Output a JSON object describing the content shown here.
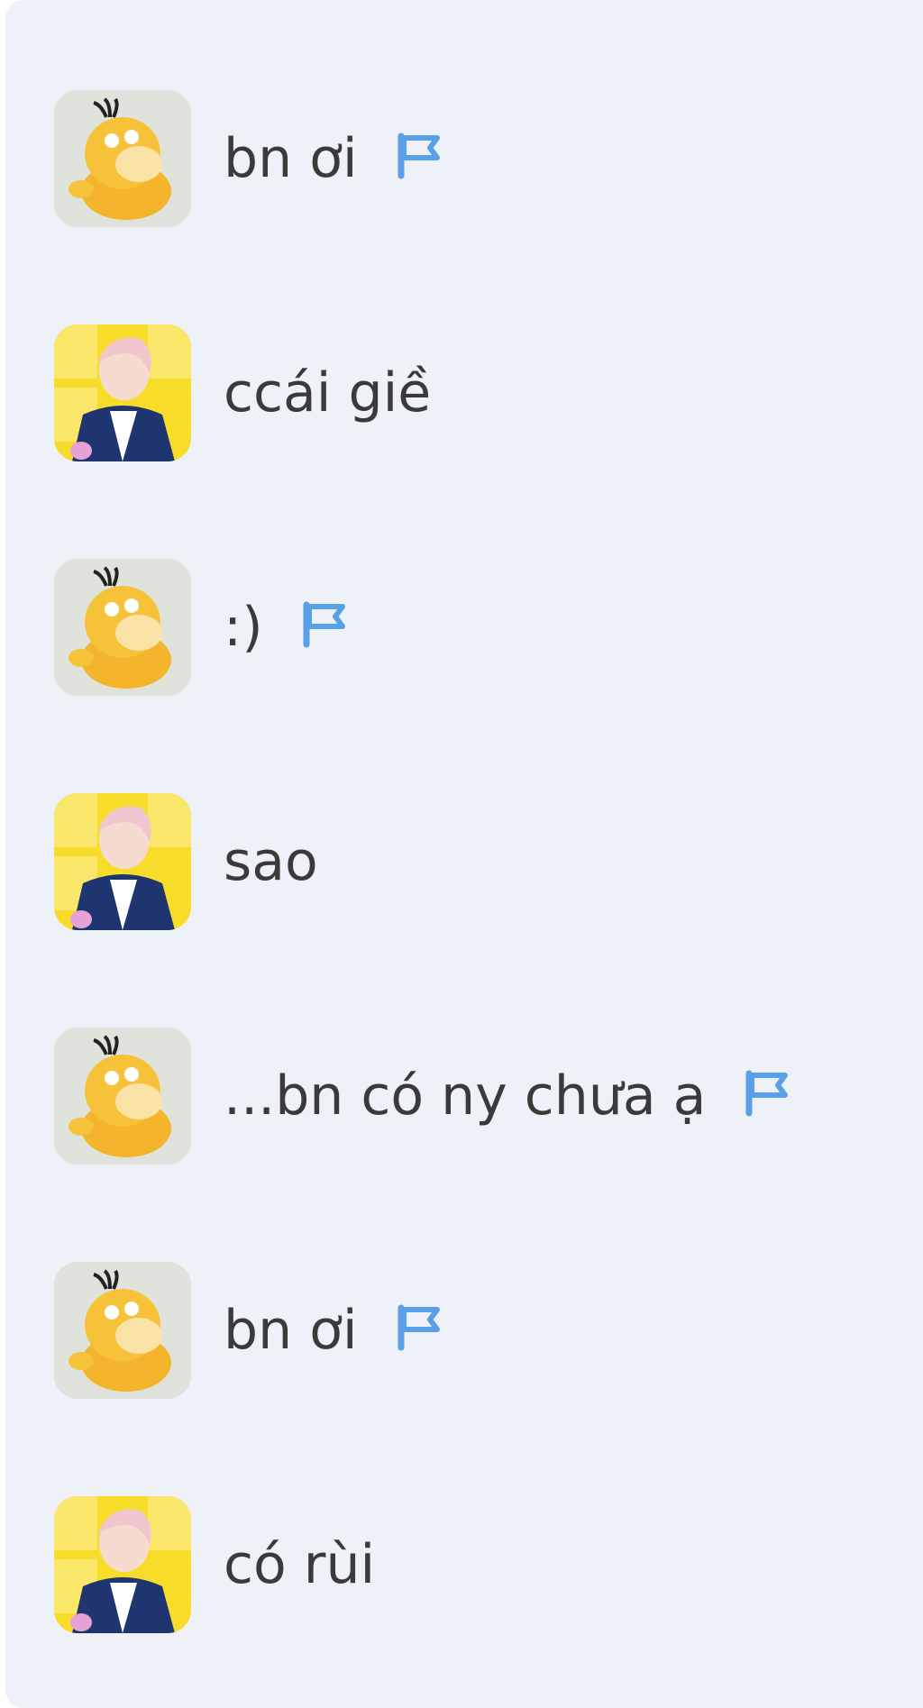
{
  "messages": [
    {
      "sender": "psyduck",
      "text": "bn ơi",
      "flagged": true
    },
    {
      "sender": "anime-boy",
      "text": "ccái giề",
      "flagged": false
    },
    {
      "sender": "psyduck",
      "text": ":)",
      "flagged": true
    },
    {
      "sender": "anime-boy",
      "text": "sao",
      "flagged": false
    },
    {
      "sender": "psyduck",
      "text": "...bn có ny chưa ạ",
      "flagged": true
    },
    {
      "sender": "psyduck",
      "text": "bn ơi",
      "flagged": true
    },
    {
      "sender": "anime-boy",
      "text": "có rùi",
      "flagged": false
    }
  ],
  "colors": {
    "panel_bg": "#eef2f8",
    "text": "#3a3a3a",
    "flag": "#5aa0e6",
    "psyduck_yellow": "#f6c23a",
    "anime_bg": "#f7dc2a",
    "anime_jacket": "#1e3570"
  },
  "icons": {
    "flag": "flag-icon",
    "psyduck_avatar": "psyduck-avatar",
    "anime_avatar": "anime-boy-avatar"
  }
}
